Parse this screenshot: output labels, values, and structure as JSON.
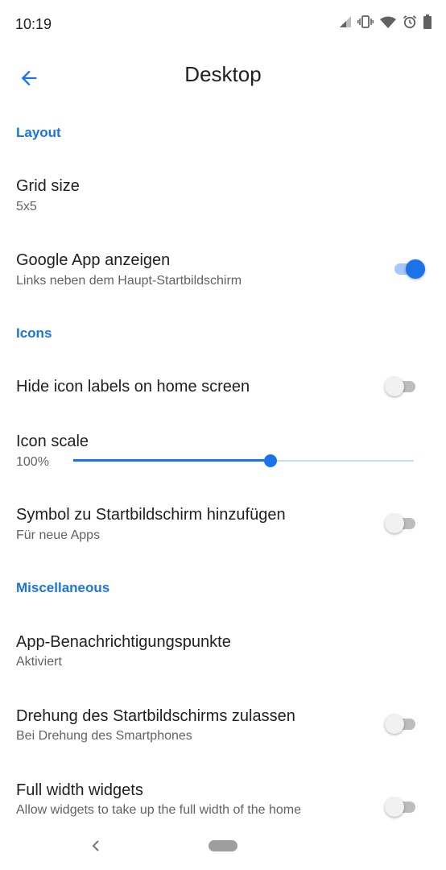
{
  "status_bar": {
    "time": "10:19",
    "icons": [
      "signal-icon",
      "vibrate-icon",
      "wifi-icon",
      "alarm-icon",
      "battery-icon"
    ]
  },
  "app_bar": {
    "title": "Desktop",
    "back_icon": "arrow-back-icon"
  },
  "sections": {
    "layout": "Layout",
    "icons": "Icons",
    "misc": "Miscellaneous"
  },
  "settings": {
    "grid_size": {
      "title": "Grid size",
      "summary": "5x5"
    },
    "google_app": {
      "title": "Google App anzeigen",
      "summary": "Links neben dem Haupt-Startbildschirm",
      "enabled": true
    },
    "hide_labels": {
      "title": "Hide icon labels on home screen",
      "enabled": false
    },
    "icon_scale": {
      "title": "Icon scale",
      "value_label": "100%",
      "slider_fraction": 0.58
    },
    "add_icon": {
      "title": "Symbol zu Startbildschirm hinzufügen",
      "summary": "Für neue Apps",
      "enabled": false
    },
    "notification_dots": {
      "title": "App-Benachrichtigungspunkte",
      "summary": "Aktiviert"
    },
    "rotation": {
      "title": "Drehung des Startbildschirms zulassen",
      "summary": "Bei Drehung des Smartphones",
      "enabled": false
    },
    "full_width": {
      "title": "Full width widgets",
      "summary": "Allow widgets to take up the full width of the home",
      "enabled": false
    }
  },
  "colors": {
    "accent": "#1a73e8",
    "text_primary": "#202124",
    "text_secondary": "#5f6368"
  }
}
